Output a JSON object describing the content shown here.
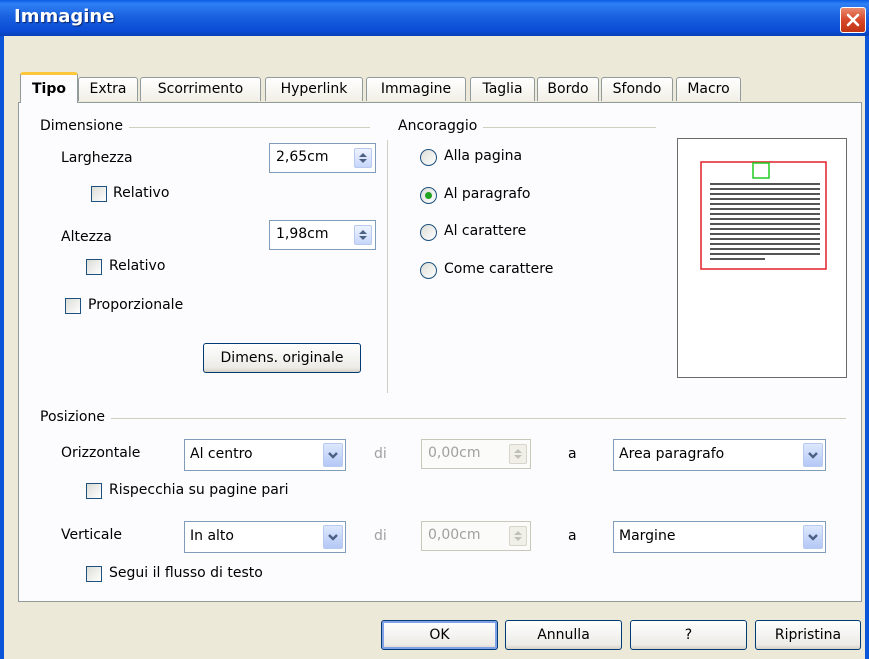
{
  "window": {
    "title": "Immagine"
  },
  "tabs": [
    "Tipo",
    "Extra",
    "Scorrimento",
    "Hyperlink",
    "Immagine",
    "Taglia",
    "Bordo",
    "Sfondo",
    "Macro"
  ],
  "size": {
    "title": "Dimensione",
    "width_label": "Larghezza",
    "width_value": "2,65cm",
    "width_relative_label": "Relativo",
    "height_label": "Altezza",
    "height_value": "1,98cm",
    "height_relative_label": "Relativo",
    "proportional_label": "Proporzionale",
    "original_size_button": "Dimens. originale"
  },
  "anchor": {
    "title": "Ancoraggio",
    "options": [
      {
        "label": "Alla pagina",
        "selected": false
      },
      {
        "label": "Al paragrafo",
        "selected": true
      },
      {
        "label": "Al carattere",
        "selected": false
      },
      {
        "label": "Come carattere",
        "selected": false
      }
    ]
  },
  "position": {
    "title": "Posizione",
    "horizontal_label": "Orizzontale",
    "horizontal_value": "Al centro",
    "by_label": "di",
    "horizontal_by_value": "0,00cm",
    "to_label": "a",
    "horizontal_to_value": "Area paragrafo",
    "mirror_label": "Rispecchia su pagine pari",
    "vertical_label": "Verticale",
    "vertical_value": "In alto",
    "vertical_by_value": "0,00cm",
    "vertical_to_value": "Margine",
    "follow_flow_label": "Segui il flusso di testo"
  },
  "buttons": {
    "ok": "OK",
    "cancel": "Annulla",
    "help": "?",
    "reset": "Ripristina"
  },
  "colors": {
    "frame_blue": "#0b55d8",
    "active_tab_accent": "#ffc83c",
    "radio_dot": "#21a121",
    "preview_anchor": "#e0202a",
    "preview_object": "#22cc22"
  }
}
